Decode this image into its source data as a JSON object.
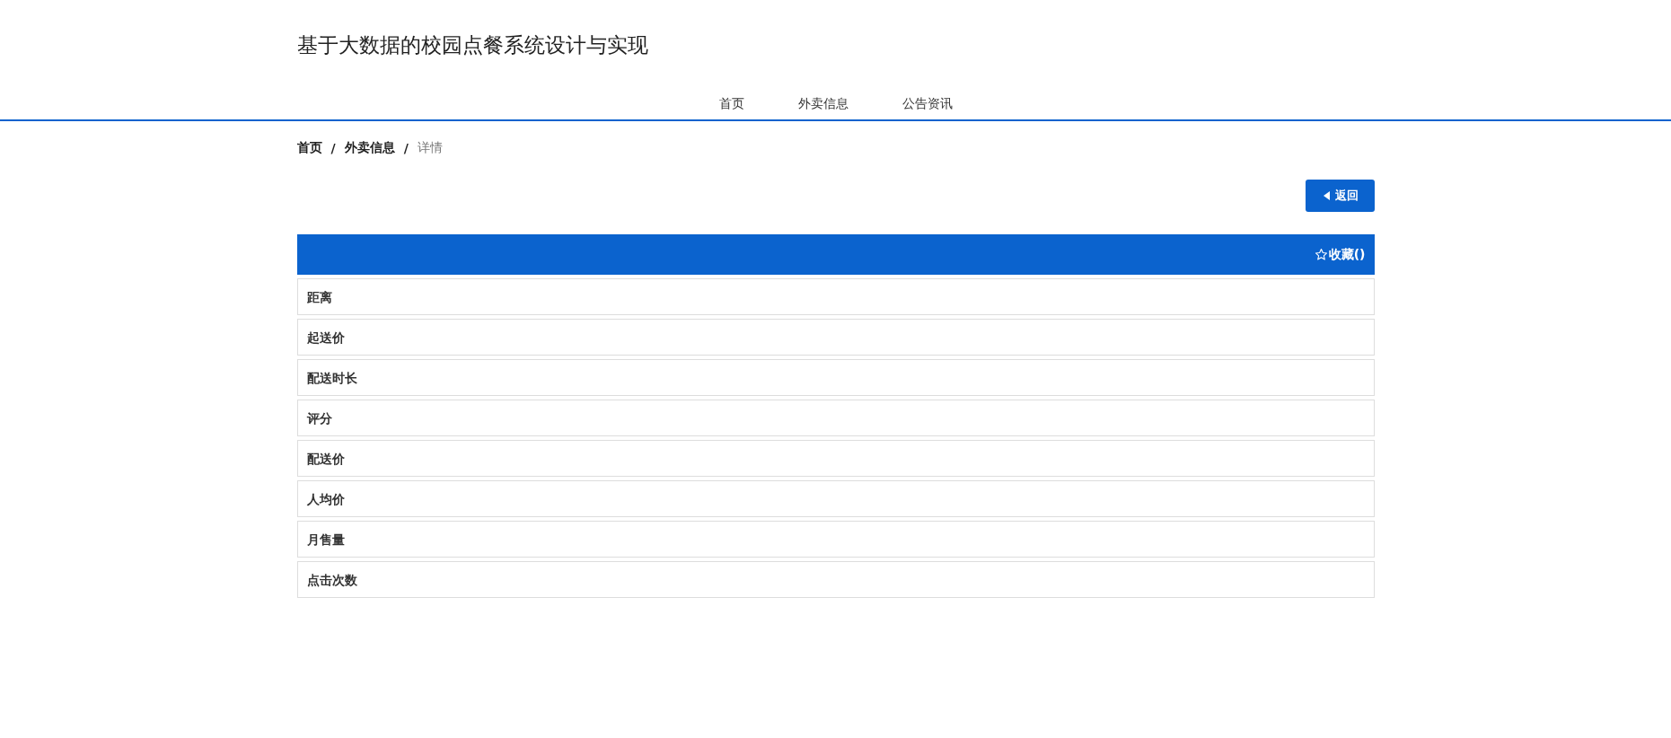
{
  "site_title": "基于大数据的校园点餐系统设计与实现",
  "nav": [
    {
      "label": "首页"
    },
    {
      "label": "外卖信息"
    },
    {
      "label": "公告资讯"
    }
  ],
  "breadcrumb": [
    {
      "label": "首页",
      "current": false
    },
    {
      "label": "外卖信息",
      "current": false
    },
    {
      "label": "详情",
      "current": true
    }
  ],
  "breadcrumb_separator": "/",
  "back_button": {
    "label": "返回"
  },
  "favorite": {
    "label": "收藏()"
  },
  "fields": [
    {
      "label": "距离"
    },
    {
      "label": "起送价"
    },
    {
      "label": "配送时长"
    },
    {
      "label": "评分"
    },
    {
      "label": "配送价"
    },
    {
      "label": "人均价"
    },
    {
      "label": "月售量"
    },
    {
      "label": "点击次数"
    }
  ]
}
